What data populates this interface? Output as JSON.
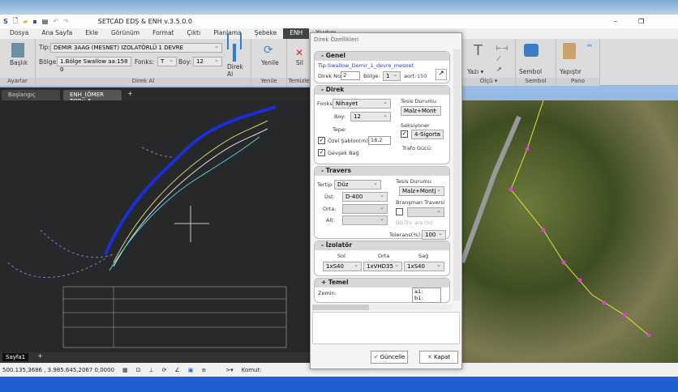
{
  "window": {
    "title": "SETCAD EDŞ & ENH v.3.5.0.0"
  },
  "menu": [
    "Dosya",
    "Ana Sayfa",
    "Ekle",
    "Görünüm",
    "Format",
    "Çıktı",
    "Planlama",
    "Şebeke",
    "ENH",
    "Yardım"
  ],
  "ribbon": {
    "ayarlar": {
      "group": "Ayarlar",
      "baslik": "Başlık"
    },
    "direk_al": {
      "group": "Direk Al",
      "tip_label": "Tip:",
      "tip_value": "DEMIR 3AAG (MESNET) IZOLATÖRLÜ 1 DEVRE",
      "bolge_label": "Bölge:",
      "bolge_value": "1.Bölge Swallow aa:150 0",
      "fonks_label": "Fonks:",
      "fonks_value": "T",
      "boy_label": "Boy:",
      "boy_value": "12",
      "button": "Direk Al"
    },
    "yenile": {
      "group": "Yenile",
      "button": "Yenile"
    },
    "temizle": {
      "group": "Temizle",
      "button": "Sil"
    },
    "olcu": {
      "group": "Ölçü ▾",
      "yazi": "Yazı ▾"
    },
    "sembol": {
      "group": "Sembol",
      "button": "Sembol"
    },
    "pano": {
      "group": "Pano",
      "button": "Yapıştır"
    }
  },
  "doc_tabs": [
    "Başlangıç",
    "ENH_(ÖMER TOP× 5"
  ],
  "sheet_tab": "Sayfa1",
  "status": {
    "coords": "500.135,3686 , 3.985.645,2067  0,0000",
    "command_label": "Komut:"
  },
  "dialog": {
    "title": "Direk Özellikleri",
    "genel": {
      "header": "- Genel",
      "tip_label": "Tip:",
      "tip_value": "Swallow_Demir_1_devre_mesnet",
      "direk_no_label": "Direk No:",
      "direk_no": "2",
      "bolge_label": "Bölge:",
      "bolge": "1",
      "aort_label": "aort:",
      "aort": "150"
    },
    "direk": {
      "header": "- Direk",
      "fonks_label": "Fonks:",
      "fonks": "Nihayet",
      "boy_label": "Boy:",
      "boy": "12",
      "tepe_label": "Tepe:",
      "ozel_label": "Özel Şablon(m):",
      "ozel_value": "18,2",
      "gevsek_label": "Gevşek Bağ",
      "tesis_label": "Tesis Durumu",
      "tesis": "Malz+Mont",
      "seksiyoner_label": "Seksiyoner",
      "seksiyoner": "4-Sigorta",
      "trafo_label": "Trafo Gücü:"
    },
    "travers": {
      "header": "- Travers",
      "tertip_label": "Tertip:",
      "tertip": "Düz",
      "ust_label": "Üst:",
      "ust": "D-400",
      "orta_label": "Orta:",
      "alt_label": "Alt:",
      "tesis_label": "Tesis Durumu",
      "tesis": "Malz+Montj",
      "brans_label": "Branşman Traversi",
      "dis_label": "Dis-Trv. ara (m)",
      "tolerans_label": "Tolerans(%):",
      "tolerans": "100"
    },
    "izolator": {
      "header": "- İzolatör",
      "sol_label": "Sol",
      "orta_label": "Orta",
      "sag_label": "Sağ",
      "sol": "1xS40",
      "orta": "1xVHD35",
      "sag": "1xS40"
    },
    "temel": {
      "header": "+ Temel",
      "zemin_label": "Zemin:",
      "a1": "a1:",
      "b1": "b1:"
    },
    "guncelle": "Güncelle",
    "kapat": "Kapat"
  }
}
